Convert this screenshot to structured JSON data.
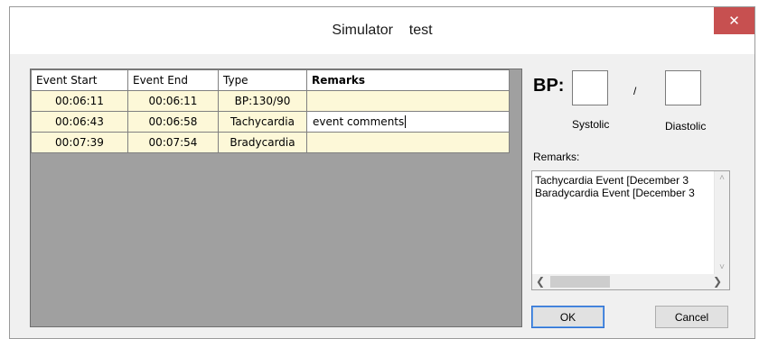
{
  "window": {
    "title": "Simulator    test",
    "close_glyph": "✕"
  },
  "grid": {
    "columns": [
      "Event Start",
      "Event End",
      "Type",
      "Remarks"
    ],
    "rows": [
      {
        "start": "00:06:11",
        "end": "00:06:11",
        "type": "BP:130/90",
        "remarks": ""
      },
      {
        "start": "00:06:43",
        "end": "00:06:58",
        "type": "Tachycardia",
        "remarks": "event comments"
      },
      {
        "start": "00:07:39",
        "end": "00:07:54",
        "type": "Bradycardia",
        "remarks": ""
      }
    ]
  },
  "bp": {
    "label": "BP:",
    "separator": "/",
    "systolic_label": "Systolic",
    "diastolic_label": "Diastolic",
    "systolic_value": "",
    "diastolic_value": ""
  },
  "remarks": {
    "label": "Remarks:",
    "lines": [
      "Tachycardia Event [December 3",
      "Baradycardia Event [December 3"
    ]
  },
  "buttons": {
    "ok": "OK",
    "cancel": "Cancel"
  }
}
